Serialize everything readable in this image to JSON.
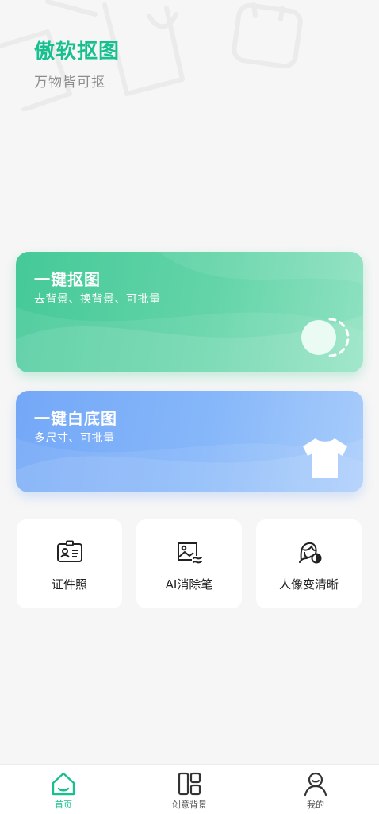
{
  "header": {
    "title": "傲软抠图",
    "subtitle": "万物皆可抠"
  },
  "cards": [
    {
      "title": "一键抠图",
      "subtitle": "去背景、换背景、可批量",
      "icon": "toggle-circle-icon"
    },
    {
      "title": "一键白底图",
      "subtitle": "多尺寸、可批量",
      "icon": "tshirt-icon"
    }
  ],
  "tools": [
    {
      "label": "证件照",
      "icon": "id-card-icon"
    },
    {
      "label": "AI消除笔",
      "icon": "image-eraser-icon"
    },
    {
      "label": "人像变清晰",
      "icon": "portrait-enhance-icon"
    }
  ],
  "tabbar": {
    "items": [
      {
        "label": "首页",
        "icon": "home-icon",
        "active": true
      },
      {
        "label": "创意背景",
        "icon": "layout-icon",
        "active": false
      },
      {
        "label": "我的",
        "icon": "user-icon",
        "active": false
      }
    ]
  },
  "colors": {
    "accent": "#18c08f",
    "green_card": "#45c998",
    "blue_card": "#74a8f7",
    "background": "#f6f6f6"
  }
}
